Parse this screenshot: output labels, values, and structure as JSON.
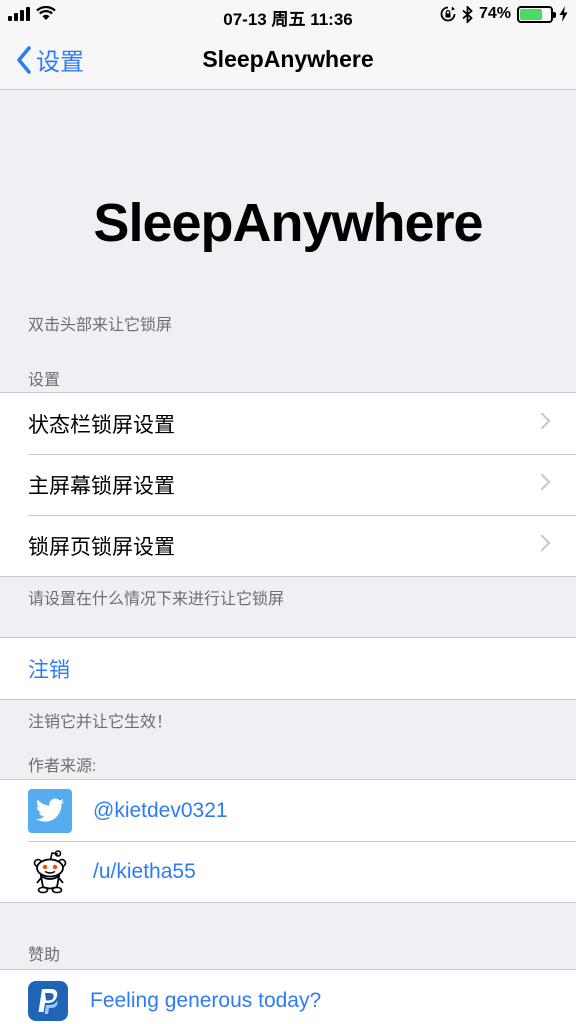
{
  "status_bar": {
    "time": "07-13 周五 11:36",
    "battery_text": "74%",
    "battery_level": 0.74
  },
  "nav": {
    "back_label": "设置",
    "title": "SleepAnywhere"
  },
  "header": {
    "title": "SleepAnywhere",
    "description": "双击头部来让它锁屏"
  },
  "settings_section": {
    "header": "设置",
    "items": [
      {
        "label": "状态栏锁屏设置"
      },
      {
        "label": "主屏幕锁屏设置"
      },
      {
        "label": "锁屏页锁屏设置"
      }
    ],
    "footer": "请设置在什么情况下来进行让它锁屏"
  },
  "respring_section": {
    "button_label": "注销",
    "footer": "注销它并让它生效！"
  },
  "author_section": {
    "header": "作者来源:",
    "items": [
      {
        "label": "@kietdev0321",
        "icon": "twitter-icon"
      },
      {
        "label": "/u/kietha55",
        "icon": "reddit-icon"
      }
    ]
  },
  "donate_section": {
    "header": "赞助",
    "items": [
      {
        "label": "Feeling generous today?",
        "icon": "paypal-icon"
      }
    ]
  },
  "colors": {
    "accent": "#2f7bf5",
    "background": "#efeff4",
    "battery": "#4cd964",
    "twitter": "#55acee",
    "paypal": "#1f64b5"
  }
}
